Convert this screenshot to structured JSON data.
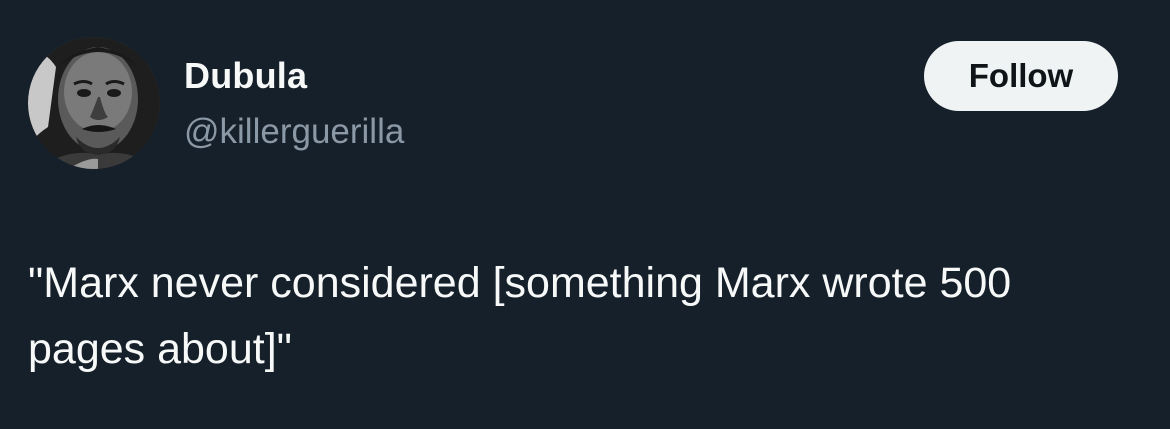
{
  "author": {
    "display_name": "Dubula",
    "handle": "@killerguerilla"
  },
  "follow_button": {
    "label": "Follow"
  },
  "tweet": {
    "text": "\"Marx never considered [something Marx wrote 500 pages about]\""
  },
  "colors": {
    "background": "#16202a",
    "primary_text": "#f7f9f9",
    "secondary_text": "#8b98a5",
    "button_bg": "#eff3f4",
    "button_text": "#0f1419"
  }
}
